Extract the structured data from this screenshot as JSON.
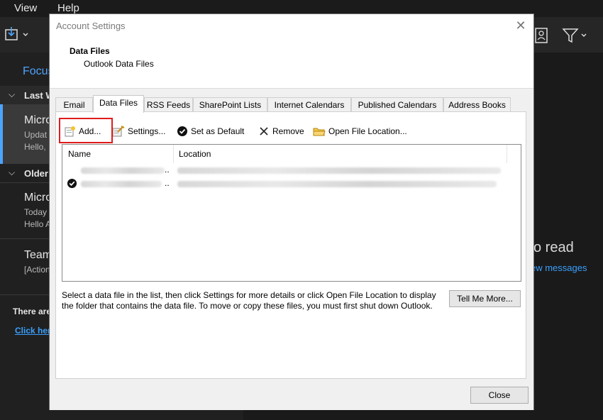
{
  "outlook": {
    "menu": {
      "view": "View",
      "help": "Help"
    },
    "focused_tab": "Focus",
    "groups": {
      "last": "Last W",
      "older": "Older"
    },
    "messages": [
      {
        "sender": "Micro",
        "line2": "Updat",
        "line3": "Hello,"
      },
      {
        "sender": "Micro",
        "line2": "Today",
        "line3": "Hello A"
      },
      {
        "sender": "Team",
        "line2": "[Action"
      }
    ],
    "footer_text": "There are",
    "footer_link": "Click her",
    "reading_pane": {
      "text": "o read",
      "link": "ew messages"
    }
  },
  "dialog": {
    "title": "Account Settings",
    "header_title": "Data Files",
    "header_subtitle": "Outlook Data Files",
    "tabs": [
      "Email",
      "Data Files",
      "RSS Feeds",
      "SharePoint Lists",
      "Internet Calendars",
      "Published Calendars",
      "Address Books"
    ],
    "active_tab": "Data Files",
    "toolbar": {
      "add": "Add...",
      "settings": "Settings...",
      "set_default": "Set as Default",
      "remove": "Remove",
      "open_location": "Open File Location..."
    },
    "list": {
      "columns": {
        "name": "Name",
        "location": "Location"
      },
      "rows": [
        {
          "name_suffix": "..",
          "is_default": false
        },
        {
          "name_suffix": "..",
          "is_default": true
        }
      ]
    },
    "hint": "Select a data file in the list, then click Settings for more details or click Open File Location to display the folder that contains the data file. To move or copy these files, you must first shut down Outlook.",
    "tell_me_more": "Tell Me More...",
    "close": "Close"
  },
  "colors": {
    "highlight": "#e01b1b",
    "link": "#3aa0ff",
    "accent": "#4da3ff"
  }
}
